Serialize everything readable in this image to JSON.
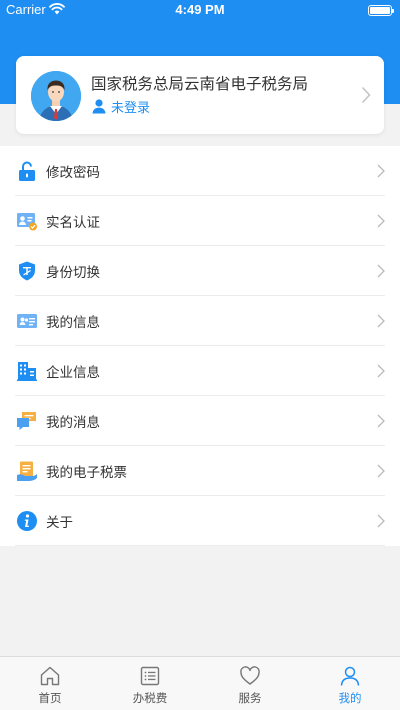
{
  "status_bar": {
    "carrier": "Carrier",
    "time": "4:49 PM"
  },
  "profile": {
    "org_name": "国家税务总局云南省电子税务局",
    "login_status": "未登录"
  },
  "menu": {
    "items": [
      {
        "label": "修改密码",
        "icon": "lock-icon"
      },
      {
        "label": "实名认证",
        "icon": "id-card-icon"
      },
      {
        "label": "身份切换",
        "icon": "shield-auth-icon"
      },
      {
        "label": "我的信息",
        "icon": "profile-card-icon"
      },
      {
        "label": "企业信息",
        "icon": "building-icon"
      },
      {
        "label": "我的消息",
        "icon": "chat-bubble-icon"
      },
      {
        "label": "我的电子税票",
        "icon": "ticket-icon"
      },
      {
        "label": "关于",
        "icon": "info-icon"
      }
    ]
  },
  "tabbar": {
    "tabs": [
      {
        "label": "首页",
        "icon": "home-icon",
        "active": false
      },
      {
        "label": "办税费",
        "icon": "list-icon",
        "active": false
      },
      {
        "label": "服务",
        "icon": "heart-icon",
        "active": false
      },
      {
        "label": "我的",
        "icon": "user-icon",
        "active": true
      }
    ]
  },
  "colors": {
    "brand": "#1e8ef3",
    "background": "#f2f2f2"
  }
}
